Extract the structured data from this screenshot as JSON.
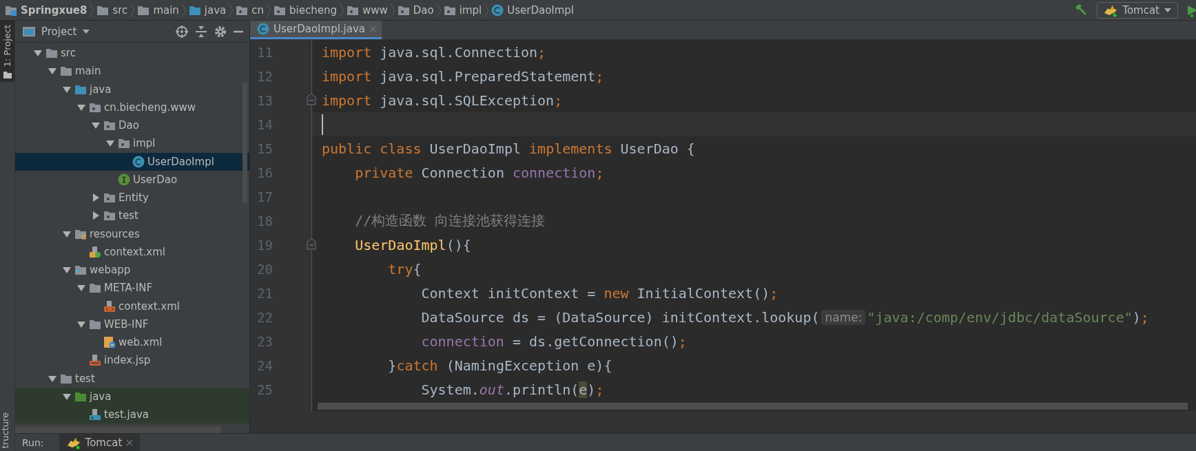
{
  "breadcrumb": [
    {
      "label": "Springxue8",
      "kind": "project"
    },
    {
      "label": "src",
      "kind": "folder"
    },
    {
      "label": "main",
      "kind": "folder"
    },
    {
      "label": "java",
      "kind": "source-folder"
    },
    {
      "label": "cn",
      "kind": "package"
    },
    {
      "label": "biecheng",
      "kind": "package"
    },
    {
      "label": "www",
      "kind": "package"
    },
    {
      "label": "Dao",
      "kind": "package"
    },
    {
      "label": "impl",
      "kind": "package"
    },
    {
      "label": "UserDaoImpl",
      "kind": "class"
    }
  ],
  "toolbar": {
    "run_config": "Tomcat"
  },
  "tool_strip": {
    "top": "1: Project",
    "bottom": "tructure"
  },
  "project_panel": {
    "title": "Project",
    "tree": [
      {
        "label": "src",
        "kind": "folder",
        "expanded": true,
        "selected": false,
        "children": [
          {
            "label": "main",
            "kind": "folder",
            "expanded": true,
            "selected": false,
            "children": [
              {
                "label": "java",
                "kind": "source-folder",
                "expanded": true,
                "selected": false,
                "children": [
                  {
                    "label": "cn.biecheng.www",
                    "kind": "package",
                    "expanded": true,
                    "selected": false,
                    "children": [
                      {
                        "label": "Dao",
                        "kind": "package",
                        "expanded": true,
                        "selected": false,
                        "children": [
                          {
                            "label": "impl",
                            "kind": "package",
                            "expanded": true,
                            "selected": false,
                            "children": [
                              {
                                "label": "UserDaoImpl",
                                "kind": "class",
                                "selected": true
                              }
                            ]
                          },
                          {
                            "label": "UserDao",
                            "kind": "interface",
                            "selected": false
                          }
                        ]
                      },
                      {
                        "label": "Entity",
                        "kind": "package",
                        "expanded": false,
                        "selected": false
                      },
                      {
                        "label": "test",
                        "kind": "package",
                        "expanded": false,
                        "selected": false
                      }
                    ]
                  }
                ]
              },
              {
                "label": "resources",
                "kind": "resources-folder",
                "expanded": true,
                "selected": false,
                "children": [
                  {
                    "label": "context.xml",
                    "kind": "spring-xml",
                    "selected": false
                  }
                ]
              },
              {
                "label": "webapp",
                "kind": "web-folder",
                "expanded": true,
                "selected": false,
                "children": [
                  {
                    "label": "META-INF",
                    "kind": "folder",
                    "expanded": true,
                    "selected": false,
                    "children": [
                      {
                        "label": "context.xml",
                        "kind": "xml",
                        "selected": false
                      }
                    ]
                  },
                  {
                    "label": "WEB-INF",
                    "kind": "folder",
                    "expanded": true,
                    "selected": false,
                    "children": [
                      {
                        "label": "web.xml",
                        "kind": "web-xml",
                        "selected": false
                      }
                    ]
                  },
                  {
                    "label": "index.jsp",
                    "kind": "jsp",
                    "selected": false
                  }
                ]
              }
            ]
          },
          {
            "label": "test",
            "kind": "folder",
            "expanded": true,
            "selected": false,
            "children": [
              {
                "label": "java",
                "kind": "test-folder",
                "expanded": true,
                "selected": false,
                "tinted": true,
                "children": [
                  {
                    "label": "test.java",
                    "kind": "java-file",
                    "selected": false,
                    "tinted": true
                  }
                ]
              }
            ]
          }
        ]
      }
    ]
  },
  "editor": {
    "tabs": [
      {
        "label": "UserDaoImpl.java",
        "kind": "class",
        "selected": true
      }
    ],
    "lines": [
      {
        "number": "11",
        "tokens": [
          {
            "text": "import",
            "kind": "keyword"
          },
          {
            "text": " java.sql.Connection",
            "kind": "plain"
          },
          {
            "text": ";",
            "kind": "keyword"
          }
        ]
      },
      {
        "number": "12",
        "tokens": [
          {
            "text": "import",
            "kind": "keyword"
          },
          {
            "text": " java.sql.PreparedStatement",
            "kind": "plain"
          },
          {
            "text": ";",
            "kind": "keyword"
          }
        ]
      },
      {
        "number": "13",
        "fold": true,
        "tokens": [
          {
            "text": "import",
            "kind": "keyword"
          },
          {
            "text": " java.sql.SQLException",
            "kind": "plain"
          },
          {
            "text": ";",
            "kind": "keyword"
          }
        ]
      },
      {
        "number": "14",
        "current": true
      },
      {
        "number": "15",
        "tokens": [
          {
            "text": "public class",
            "kind": "keyword"
          },
          {
            "text": " UserDaoImpl ",
            "kind": "plain"
          },
          {
            "text": "implements",
            "kind": "keyword"
          },
          {
            "text": " UserDao {",
            "kind": "plain"
          }
        ]
      },
      {
        "number": "16",
        "tokens": [
          {
            "text": "    private",
            "kind": "keyword"
          },
          {
            "text": " Connection ",
            "kind": "plain"
          },
          {
            "text": "connection",
            "kind": "field"
          },
          {
            "text": ";",
            "kind": "keyword"
          }
        ]
      },
      {
        "number": "17"
      },
      {
        "number": "18",
        "tokens": [
          {
            "text": "    //构造函数 向连接池获得连接",
            "kind": "comment"
          }
        ]
      },
      {
        "number": "19",
        "fold": true,
        "tokens": [
          {
            "text": "    UserDaoImpl",
            "kind": "declaration"
          },
          {
            "text": "(){",
            "kind": "plain"
          }
        ]
      },
      {
        "number": "20",
        "tokens": [
          {
            "text": "        try",
            "kind": "keyword"
          },
          {
            "text": "{",
            "kind": "plain"
          }
        ]
      },
      {
        "number": "21",
        "tokens": [
          {
            "text": "            Context initContext = ",
            "kind": "plain"
          },
          {
            "text": "new",
            "kind": "keyword"
          },
          {
            "text": " InitialContext()",
            "kind": "plain"
          },
          {
            "text": ";",
            "kind": "keyword"
          }
        ]
      },
      {
        "number": "22",
        "tokens": [
          {
            "text": "            DataSource ds = (DataSource) initContext.lookup(",
            "kind": "plain"
          },
          {
            "text": "name:",
            "kind": "hint"
          },
          {
            "text": "\"java:/comp/env/jdbc/dataSource\"",
            "kind": "string"
          },
          {
            "text": ")",
            "kind": "plain"
          },
          {
            "text": ";",
            "kind": "keyword"
          }
        ]
      },
      {
        "number": "23",
        "tokens": [
          {
            "text": "            connection",
            "kind": "field"
          },
          {
            "text": " = ds.getConnection()",
            "kind": "plain"
          },
          {
            "text": ";",
            "kind": "keyword"
          }
        ]
      },
      {
        "number": "24",
        "tokens": [
          {
            "text": "        }",
            "kind": "plain"
          },
          {
            "text": "catch",
            "kind": "keyword"
          },
          {
            "text": " (NamingException e){",
            "kind": "plain"
          }
        ]
      },
      {
        "number": "25",
        "tokens": [
          {
            "text": "            System.",
            "kind": "plain"
          },
          {
            "text": "out",
            "kind": "static"
          },
          {
            "text": ".println(",
            "kind": "plain"
          },
          {
            "text": "e",
            "kind": "highlight"
          },
          {
            "text": ")",
            "kind": "plain"
          },
          {
            "text": ";",
            "kind": "keyword"
          }
        ]
      }
    ]
  },
  "run_bar": {
    "label": "Run:",
    "tabs": [
      {
        "label": "Tomcat",
        "selected": true
      }
    ]
  }
}
